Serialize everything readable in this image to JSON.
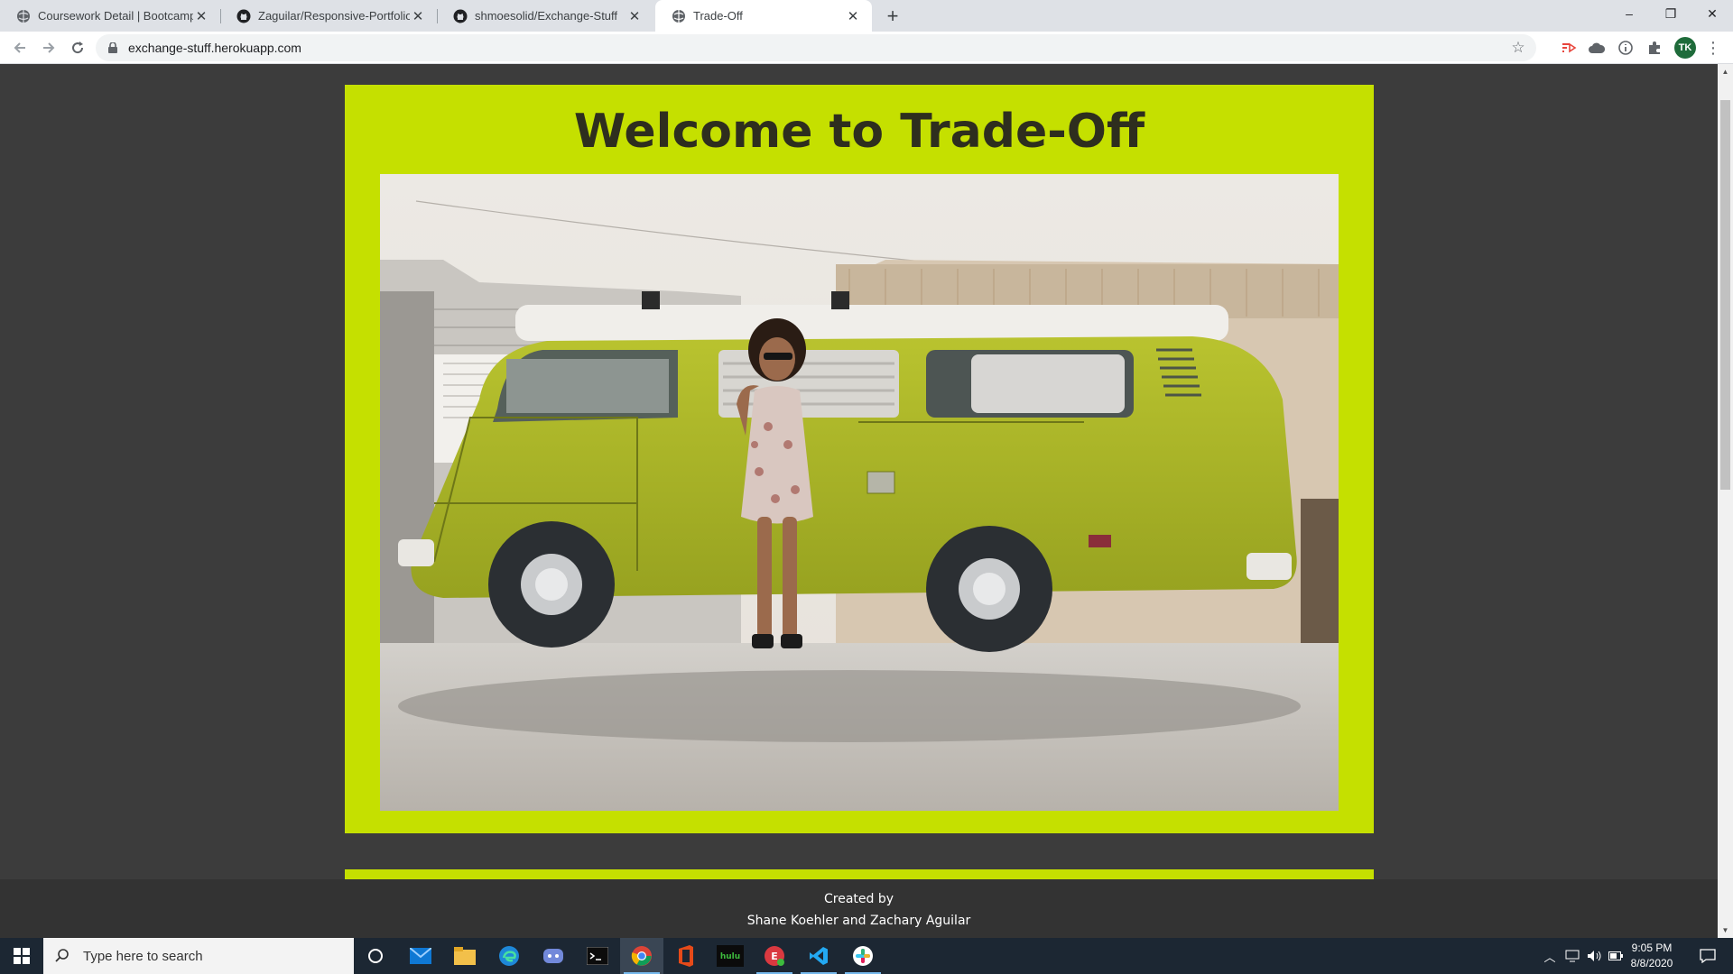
{
  "browser": {
    "tabs": [
      {
        "title": "Coursework Detail | Bootcamp Sp",
        "icon": "globe-icon"
      },
      {
        "title": "Zaguilar/Responsive-Portfolio",
        "icon": "github-icon"
      },
      {
        "title": "shmoesolid/Exchange-Stuff",
        "icon": "github-icon"
      },
      {
        "title": "Trade-Off",
        "icon": "globe-icon",
        "active": true
      }
    ],
    "new_tab": "+",
    "url": "exchange-stuff.herokuapp.com",
    "profile_initials": "TK",
    "window_controls": {
      "minimize": "–",
      "restore": "❐",
      "close": "✕"
    }
  },
  "page": {
    "title": "Welcome to Trade-Off",
    "hero_image_alt": "Woman in sunglasses leaning against a lime green VW camper van",
    "footer": {
      "line1": "Created by",
      "line2": "Shane Koehler and Zachary Aguilar"
    },
    "colors": {
      "accent": "#c5e000",
      "background": "#3c3c3c",
      "footer": "#333333",
      "van": "#a8b42a"
    }
  },
  "taskbar": {
    "search_placeholder": "Type here to search",
    "apps": [
      "cortana-icon",
      "mail-icon",
      "file-explorer-icon",
      "edge-icon",
      "discord-icon",
      "terminal-icon",
      "chrome-icon",
      "office-icon",
      "hulu-icon",
      "expressvpn-icon",
      "vscode-icon",
      "slack-icon"
    ],
    "clock_time": "9:05 PM",
    "clock_date": "8/8/2020"
  }
}
